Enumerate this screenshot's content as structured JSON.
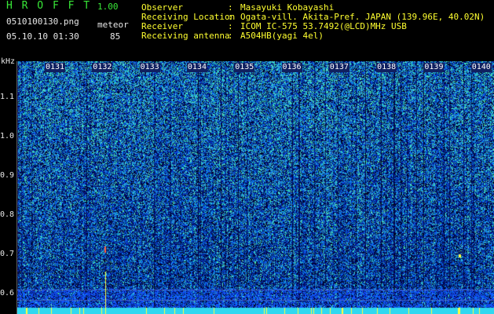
{
  "header": {
    "app_title": "H R O F F T",
    "version": "1.00",
    "file_name": "0510100130.png",
    "mode_label": "meteor",
    "datetime": "05.10.10 01:30",
    "meteor_count": "85"
  },
  "station_info": [
    {
      "label": "Observer",
      "value": "Masayuki Kobayashi"
    },
    {
      "label": "Receiving Location",
      "value": "Ogata-vill. Akita-Pref. JAPAN (139.96E, 40.02N)"
    },
    {
      "label": "Receiver",
      "value": "ICOM IC-575 53.7492(@LCD)MHz USB"
    },
    {
      "label": "Receiving antenna",
      "value": "A504HB(yagi 4el)"
    }
  ],
  "spectrogram": {
    "y_unit": "kHz",
    "y_ticks": [
      "1.1",
      "1.0",
      "0.9",
      "0.8",
      "0.7",
      "0.6"
    ],
    "x_ticks": [
      "0131",
      "0132",
      "0133",
      "0134",
      "0135",
      "0136",
      "0137",
      "0138",
      "0139",
      "0140"
    ],
    "palette": {
      "background": "#000000",
      "low": "#0a1a80",
      "mid": "#2050ff",
      "high": "#30e0c0",
      "peak": "#ffff40"
    }
  }
}
